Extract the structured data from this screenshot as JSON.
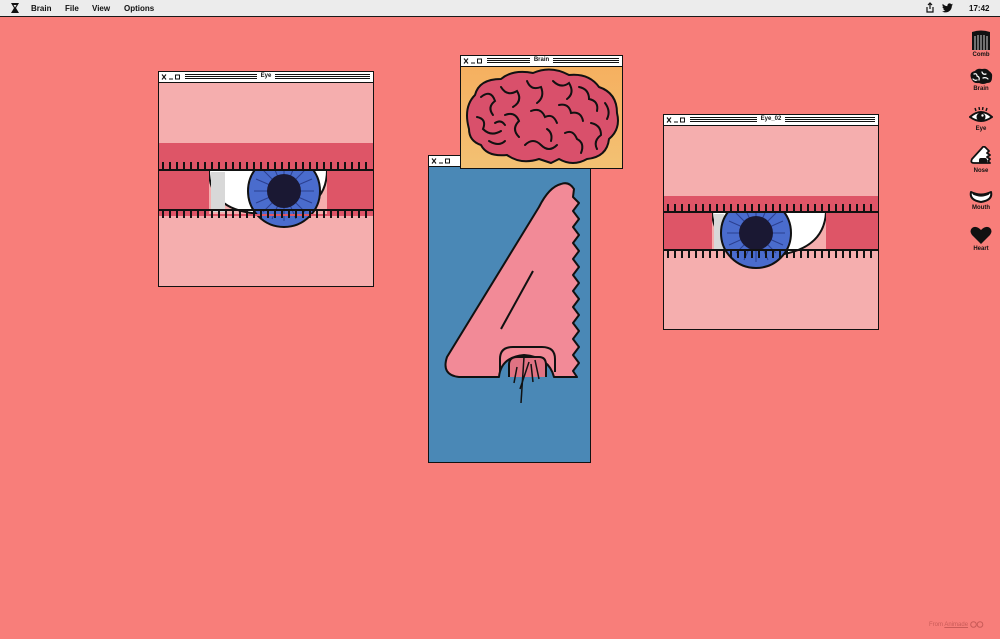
{
  "menubar": {
    "app_name": "Brain",
    "items": [
      "File",
      "View",
      "Options"
    ],
    "clock": "17:42",
    "icons": [
      "x-logo-icon",
      "share-icon",
      "twitter-icon"
    ]
  },
  "windows": {
    "eye": {
      "title": "Eye"
    },
    "brain": {
      "title": "Brain"
    },
    "eye02": {
      "title": "Eye_02"
    },
    "nose": {
      "title": ""
    }
  },
  "dock": {
    "items": [
      {
        "label": "Comb",
        "icon": "comb-icon"
      },
      {
        "label": "Brain",
        "icon": "brain-icon"
      },
      {
        "label": "Eye",
        "icon": "eye-icon"
      },
      {
        "label": "Nose",
        "icon": "nose-icon"
      },
      {
        "label": "Mouth",
        "icon": "mouth-icon"
      },
      {
        "label": "Heart",
        "icon": "heart-icon"
      }
    ]
  },
  "footer": {
    "prefix": "From",
    "link": "Animade"
  },
  "colors": {
    "desktop": "#f87e7a",
    "window_pink": "#f5aeae",
    "lid_red": "#de5567",
    "iris_blue": "#4a6ccd",
    "nose_bg": "#4a88b6",
    "nose_pink": "#f28a97",
    "brain_bg": "#f5b65f",
    "brain_pink": "#d9506b"
  }
}
